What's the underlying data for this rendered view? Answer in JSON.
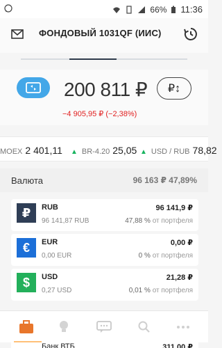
{
  "status": {
    "battery": "66%",
    "time": "11:36"
  },
  "header": {
    "title": "ФОНДОВЫЙ 1031QF (ИИС)",
    "left_icon": "mail-icon",
    "right_icon": "history-icon"
  },
  "balance": {
    "total": "200 811 ₽",
    "delta": "−4 905,95 ₽ (−2,38%)",
    "currency_button": "₽↕"
  },
  "tickers": [
    {
      "label": "MOEX",
      "value": "2 401,11"
    },
    {
      "label": "BR-4.20",
      "value": "25,05"
    },
    {
      "label": "USD / RUB",
      "value": "78,82"
    }
  ],
  "section": {
    "title": "Валюта",
    "sum": "96 163 ₽  47,89%"
  },
  "cards": [
    {
      "symbol": "₽",
      "name": "RUB",
      "sub": "96 141,87 RUB",
      "amount": "96 141,9 ₽",
      "pct": "47,88 %",
      "pct_label": "от портфеля",
      "color": "#2f3e56"
    },
    {
      "symbol": "€",
      "name": "EUR",
      "sub": "0,00 EUR",
      "amount": "0,00 ₽",
      "pct": "0 %",
      "pct_label": "от портфеля",
      "color": "#1c6fd8"
    },
    {
      "symbol": "$",
      "name": "USD",
      "sub": "0,27 USD",
      "amount": "21,28 ₽",
      "pct": "0,01 %",
      "pct_label": "от портфеля",
      "color": "#23b05b"
    }
  ],
  "peek": {
    "name": "Банк ВТБ",
    "amount": "311,00 ₽"
  },
  "nav": {
    "active_color": "#e8762b"
  }
}
